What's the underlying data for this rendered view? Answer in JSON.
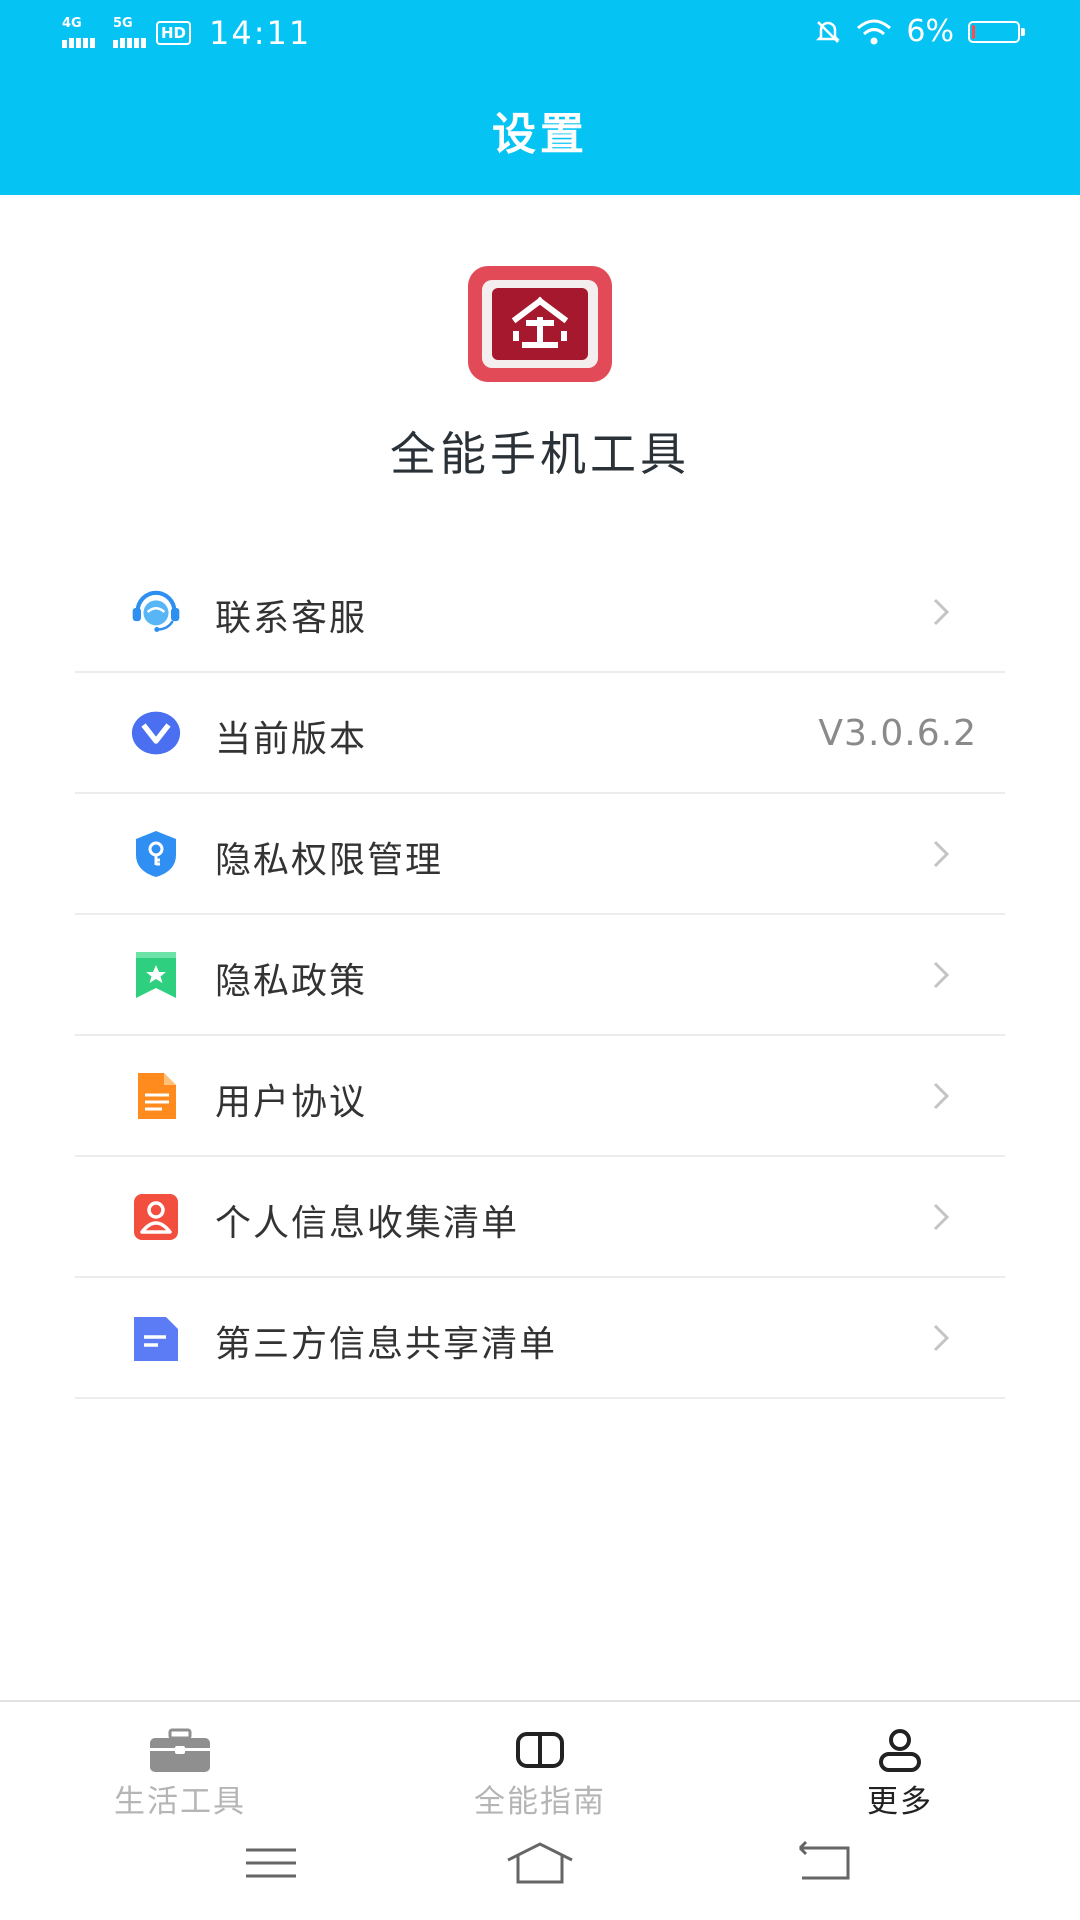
{
  "status_bar": {
    "time": "14:11",
    "signal1_label": "4G",
    "signal2_label": "5G",
    "hd_label": "HD",
    "battery_percent": "6%",
    "battery_level": 0.06
  },
  "header": {
    "title": "设置"
  },
  "app": {
    "name": "全能手机工具"
  },
  "settings": [
    {
      "label": "联系客服",
      "icon": "customer-service-icon"
    },
    {
      "label": "当前版本",
      "icon": "version-icon",
      "value": "V3.0.6.2"
    },
    {
      "label": "隐私权限管理",
      "icon": "privacy-shield-icon"
    },
    {
      "label": "隐私政策",
      "icon": "policy-bookmark-icon"
    },
    {
      "label": "用户协议",
      "icon": "document-icon"
    },
    {
      "label": "个人信息收集清单",
      "icon": "person-icon"
    },
    {
      "label": "第三方信息共享清单",
      "icon": "list-doc-icon"
    }
  ],
  "bottom_nav": [
    {
      "label": "生活工具",
      "icon": "toolbox-icon",
      "active": false
    },
    {
      "label": "全能指南",
      "icon": "book-icon",
      "active": false
    },
    {
      "label": "更多",
      "icon": "user-icon",
      "active": true
    }
  ],
  "colors": {
    "accent": "#05c3f2",
    "inactive_tab": "#b5b5b5",
    "active_tab": "#222222"
  }
}
